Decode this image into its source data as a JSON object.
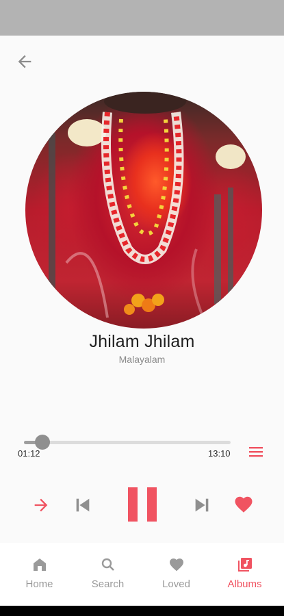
{
  "colors": {
    "accent": "#f05361",
    "muted": "#9a9a9a",
    "status_bar": "#b3b3b3"
  },
  "header": {
    "back_icon": "arrow-left-icon"
  },
  "now_playing": {
    "title": "Jhilam Jhilam",
    "subtitle": "Malayalam",
    "artwork_icon": "album-art"
  },
  "progress": {
    "current": "01:12",
    "total": "13:10",
    "fraction": 0.09
  },
  "controls": {
    "shuffle_icon": "arrow-right-icon",
    "previous_icon": "skip-previous-icon",
    "play_pause_icon": "pause-icon",
    "next_icon": "skip-next-icon",
    "favorite_icon": "heart-icon",
    "queue_icon": "queue-icon"
  },
  "nav": {
    "items": [
      {
        "label": "Home",
        "icon": "home-icon"
      },
      {
        "label": "Search",
        "icon": "search-icon"
      },
      {
        "label": "Loved",
        "icon": "heart-icon"
      },
      {
        "label": "Albums",
        "icon": "albums-icon"
      }
    ],
    "active_index": 3
  }
}
